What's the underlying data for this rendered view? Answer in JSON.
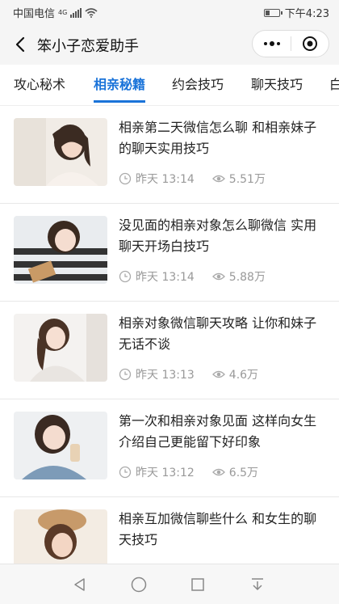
{
  "status_bar": {
    "carrier": "中国电信",
    "network": "4G",
    "time": "下午4:23",
    "battery_level": 0.35
  },
  "nav": {
    "title": "笨小子恋爱助手"
  },
  "tabs": [
    {
      "label": "攻心秘术",
      "active": false
    },
    {
      "label": "相亲秘籍",
      "active": true
    },
    {
      "label": "约会技巧",
      "active": false
    },
    {
      "label": "聊天技巧",
      "active": false
    },
    {
      "label": "白",
      "active": false
    }
  ],
  "articles": [
    {
      "title": "相亲第二天微信怎么聊 和相亲妹子的聊天实用技巧",
      "time": "昨天 13:14",
      "views": "5.51万"
    },
    {
      "title": "没见面的相亲对象怎么聊微信 实用聊天开场白技巧",
      "time": "昨天 13:14",
      "views": "5.88万"
    },
    {
      "title": "相亲对象微信聊天攻略 让你和妹子无话不谈",
      "time": "昨天 13:13",
      "views": "4.6万"
    },
    {
      "title": "第一次和相亲对象见面 这样向女生介绍自己更能留下好印象",
      "time": "昨天 13:12",
      "views": "6.5万"
    },
    {
      "title": "相亲互加微信聊些什么 和女生的聊天技巧",
      "time": "",
      "views": ""
    }
  ],
  "colors": {
    "accent": "#1a73d9",
    "meta_text": "#999999",
    "bar_bg": "#f5f5f5"
  },
  "icons": {
    "back": "chevron-left-icon",
    "more": "more-dots-icon",
    "close": "target-close-icon",
    "time": "clock-icon",
    "views": "eye-icon",
    "sys_back": "triangle-back-icon",
    "sys_home": "circle-home-icon",
    "sys_recent": "square-recent-icon",
    "sys_down": "download-arrow-icon"
  }
}
